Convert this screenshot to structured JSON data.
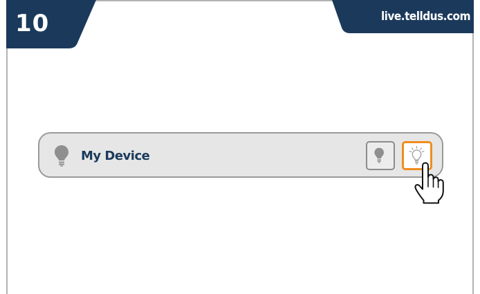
{
  "step": {
    "number": "10"
  },
  "site": {
    "url": "live.telldus.com"
  },
  "device_row": {
    "name": "My Device",
    "off_button_icon": "bulb-off-icon",
    "on_button_icon": "bulb-on-icon",
    "row_icon": "bulb-icon"
  },
  "pointer": {
    "icon": "hand-pointer-icon"
  },
  "colors": {
    "header_navy": "#1b3a5b",
    "accent_orange": "#f08c1e",
    "row_background": "#e6e6e6",
    "row_border": "#999999"
  }
}
